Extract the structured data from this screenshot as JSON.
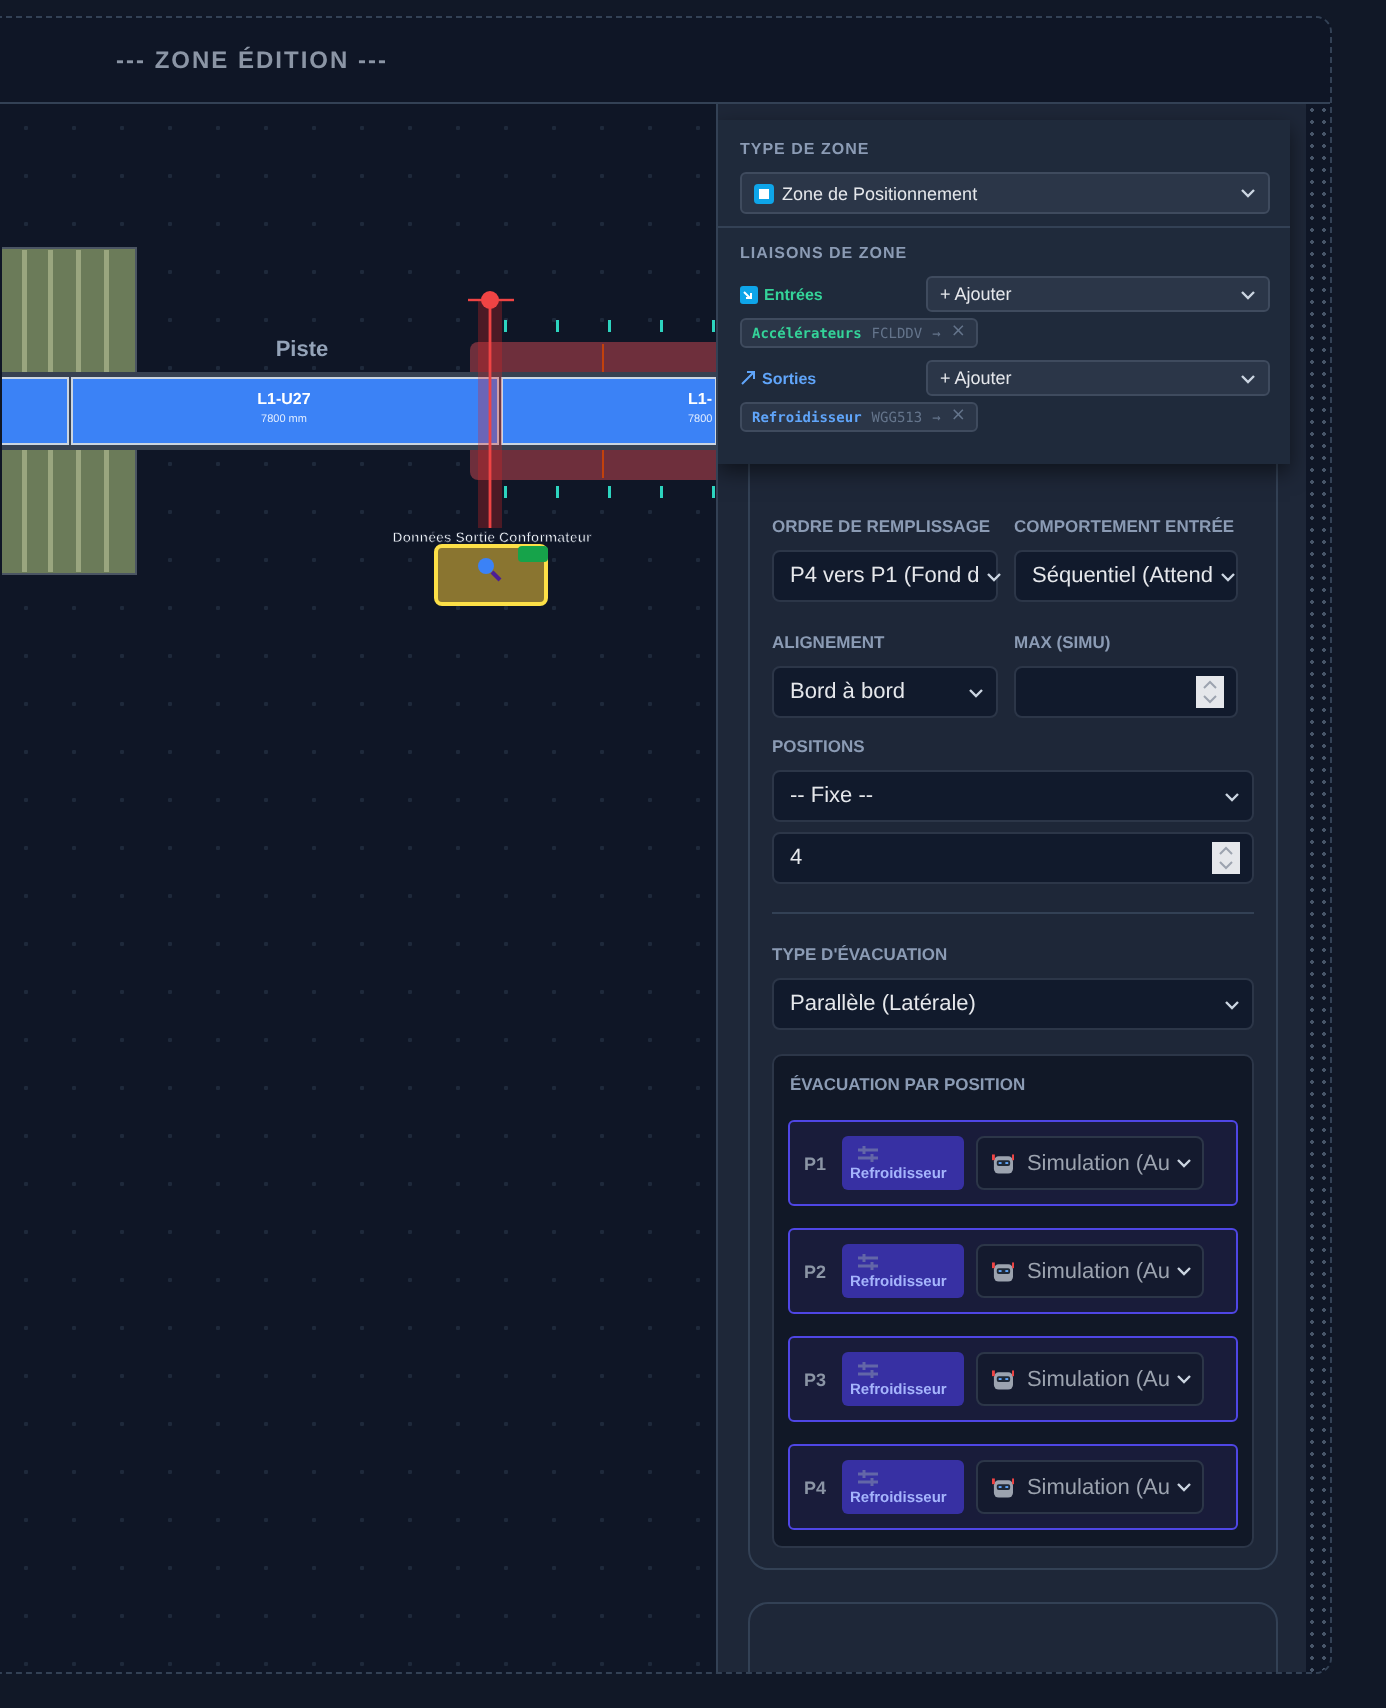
{
  "header": {
    "title": "--- ZONE ÉDITION ---"
  },
  "canvas": {
    "track_label": "Piste",
    "segments": [
      {
        "code": "L1-U27",
        "length": "7800 mm"
      },
      {
        "code": "L1-",
        "length": "7800"
      }
    ],
    "marker": {
      "label": "Données Sortie Conformateur"
    }
  },
  "zone_type": {
    "label": "TYPE DE ZONE",
    "value": "Zone de Positionnement"
  },
  "links": {
    "label": "LIAISONS DE ZONE",
    "groups": [
      {
        "kind": "input",
        "label": "Entrées",
        "add": "+ Ajouter",
        "chip": {
          "name": "Accélérateurs",
          "code": "FCLDDV",
          "arrow": "→",
          "remove": "×"
        }
      },
      {
        "kind": "output",
        "label": "Sorties",
        "add": "+ Ajouter",
        "chip": {
          "name": "Refroidisseur",
          "code": "WGG513",
          "arrow": "→",
          "remove": "×"
        }
      }
    ]
  },
  "config": {
    "fill_order": {
      "label": "ORDRE DE REMPLISSAGE",
      "value": "P4 vers P1 (Fond d"
    },
    "entry_behavior": {
      "label": "COMPORTEMENT ENTRÉE",
      "value": "Séquentiel (Attend"
    },
    "alignment": {
      "label": "ALIGNEMENT",
      "value": "Bord à bord"
    },
    "max_sim": {
      "label": "MAX (SIMU)"
    },
    "positions": {
      "label": "POSITIONS",
      "mode": "-- Fixe --",
      "count": "4"
    },
    "evacuation_type": {
      "label": "TYPE D'ÉVACUATION",
      "value": "Parallèle (Latérale)"
    },
    "evacuation": {
      "title": "ÉVACUATION PAR POSITION",
      "rows": [
        {
          "position": "P1",
          "target": "Refroidisseur",
          "mode": "Simulation (Au"
        },
        {
          "position": "P2",
          "target": "Refroidisseur",
          "mode": "Simulation (Au"
        },
        {
          "position": "P3",
          "target": "Refroidisseur",
          "mode": "Simulation (Au"
        },
        {
          "position": "P4",
          "target": "Refroidisseur",
          "mode": "Simulation (Au"
        }
      ]
    }
  }
}
